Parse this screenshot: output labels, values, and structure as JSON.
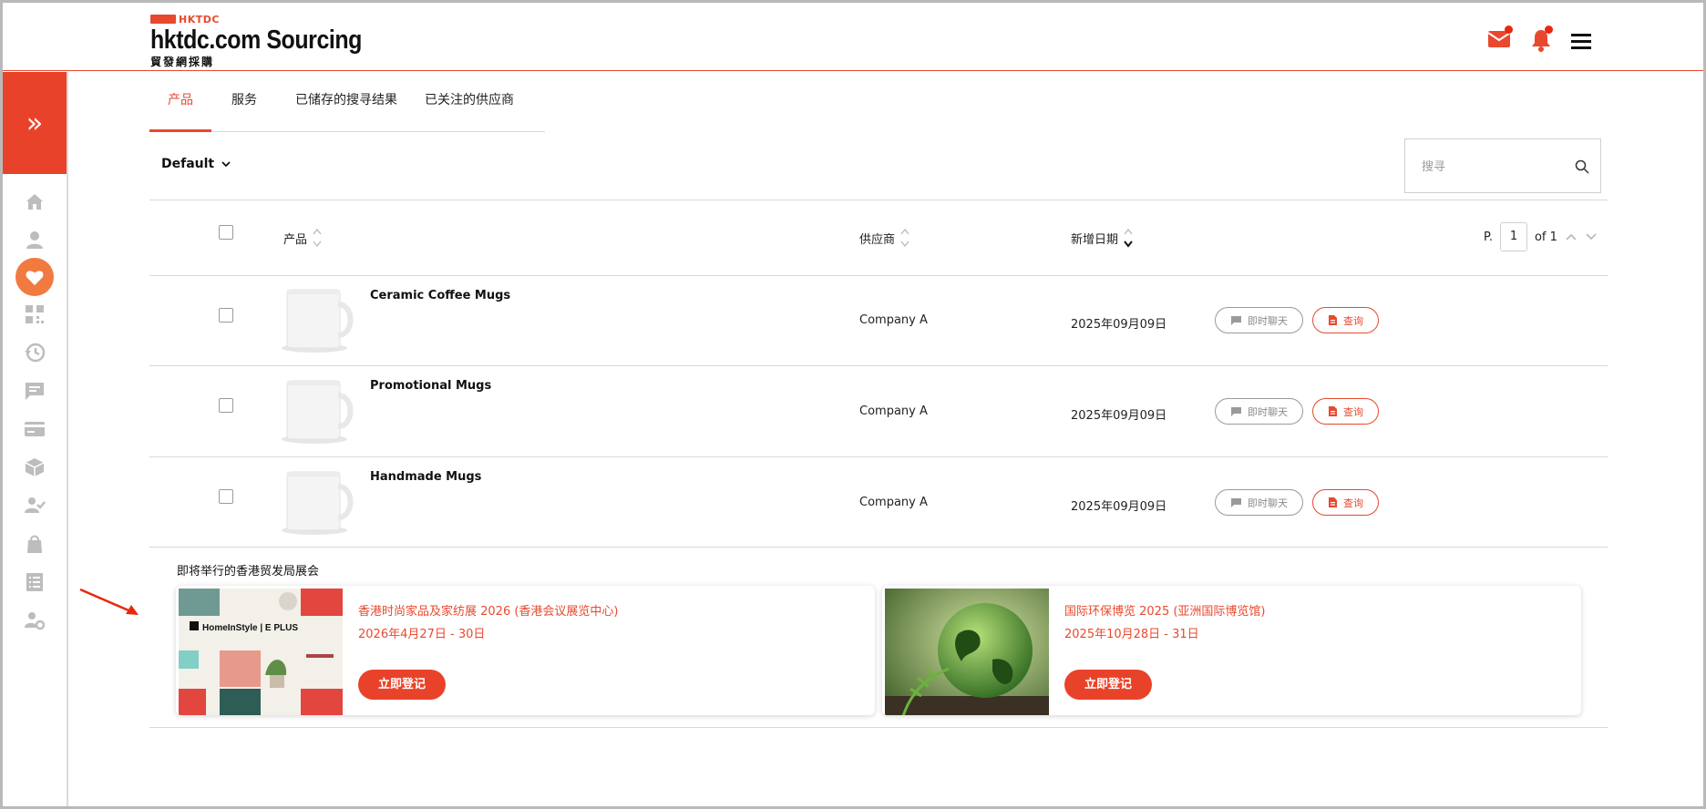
{
  "brand": {
    "abbr": "HKTDC",
    "name": "hktdc.com Sourcing",
    "subname": "貿發網採購"
  },
  "header": {
    "icons": [
      "mail-icon",
      "bell-icon",
      "menu-icon"
    ],
    "accent": "#e8492e"
  },
  "sidebar": {
    "items": [
      "home-icon",
      "user-icon",
      "heart-icon",
      "qr-icon",
      "history-icon",
      "chat-icon",
      "card-icon",
      "box-icon",
      "user-check-icon",
      "bag-icon",
      "list-icon",
      "user-settings-icon"
    ],
    "active": "heart-icon"
  },
  "tabs": [
    {
      "label": "产品",
      "active": true
    },
    {
      "label": "服务",
      "active": false
    },
    {
      "label": "已储存的搜寻结果",
      "active": false
    },
    {
      "label": "已关注的供应商",
      "active": false
    }
  ],
  "toolbar": {
    "sort_label": "Default",
    "search_placeholder": "搜寻"
  },
  "table": {
    "headers": {
      "product": "产品",
      "supplier": "供应商",
      "date": "新增日期"
    },
    "pager": {
      "prefix": "P.",
      "page": "1",
      "suffix": "of 1"
    },
    "rows": [
      {
        "name": "Ceramic Coffee Mugs",
        "supplier": "Company A",
        "date": "2025年09月09日",
        "chat": "即时聊天",
        "inquiry": "查询"
      },
      {
        "name": "Promotional Mugs",
        "supplier": "Company A",
        "date": "2025年09月09日",
        "chat": "即时聊天",
        "inquiry": "查询"
      },
      {
        "name": "Handmade Mugs",
        "supplier": "Company A",
        "date": "2025年09月09日",
        "chat": "即时聊天",
        "inquiry": "查询"
      }
    ]
  },
  "events": {
    "title": "即将举行的香港贸发局展会",
    "cards": [
      {
        "title": "香港时尚家品及家纺展 2026 (香港会议展览中心)",
        "date": "2026年4月27日 - 30日",
        "button": "立即登记",
        "image_label": "HomeInStyle | E PLUS"
      },
      {
        "title": "国际环保博览 2025 (亚洲国际博览馆)",
        "date": "2025年10月28日 - 31日",
        "button": "立即登记"
      }
    ]
  }
}
